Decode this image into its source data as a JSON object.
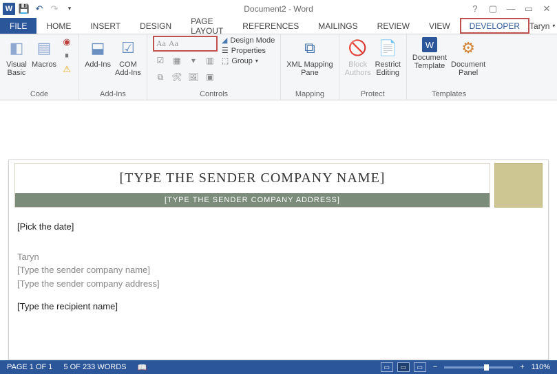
{
  "titlebar": {
    "doc_title": "Document2 - Word"
  },
  "tabs": {
    "file": "FILE",
    "home": "HOME",
    "insert": "INSERT",
    "design": "DESIGN",
    "page_layout": "PAGE LAYOUT",
    "references": "REFERENCES",
    "mailings": "MAILINGS",
    "review": "REVIEW",
    "view": "VIEW",
    "developer": "DEVELOPER"
  },
  "user": {
    "name": "Taryn"
  },
  "ribbon": {
    "code": {
      "visual_basic": "Visual\nBasic",
      "macros": "Macros",
      "label": "Code"
    },
    "addins": {
      "addins": "Add-Ins",
      "com": "COM\nAdd-Ins",
      "label": "Add-Ins"
    },
    "controls": {
      "design_mode": "Design Mode",
      "properties": "Properties",
      "group": "Group",
      "label": "Controls",
      "aa1": "Aa",
      "aa2": "Aa"
    },
    "mapping": {
      "btn": "XML Mapping\nPane",
      "label": "Mapping"
    },
    "protect": {
      "block": "Block\nAuthors",
      "restrict": "Restrict\nEditing",
      "label": "Protect"
    },
    "templates": {
      "template": "Document\nTemplate",
      "panel": "Document\nPanel",
      "label": "Templates"
    }
  },
  "document": {
    "hdr_title": "[TYPE THE SENDER COMPANY NAME]",
    "hdr_sub": "[TYPE THE SENDER COMPANY ADDRESS]",
    "date": "[Pick the date]",
    "sender_name": "Taryn",
    "sender_company": "[Type the sender company name]",
    "sender_address": "[Type the sender company address]",
    "recipient": "[Type the recipient name]"
  },
  "status": {
    "page": "PAGE 1 OF 1",
    "words": "5 OF 233 WORDS",
    "zoom": "110%"
  }
}
